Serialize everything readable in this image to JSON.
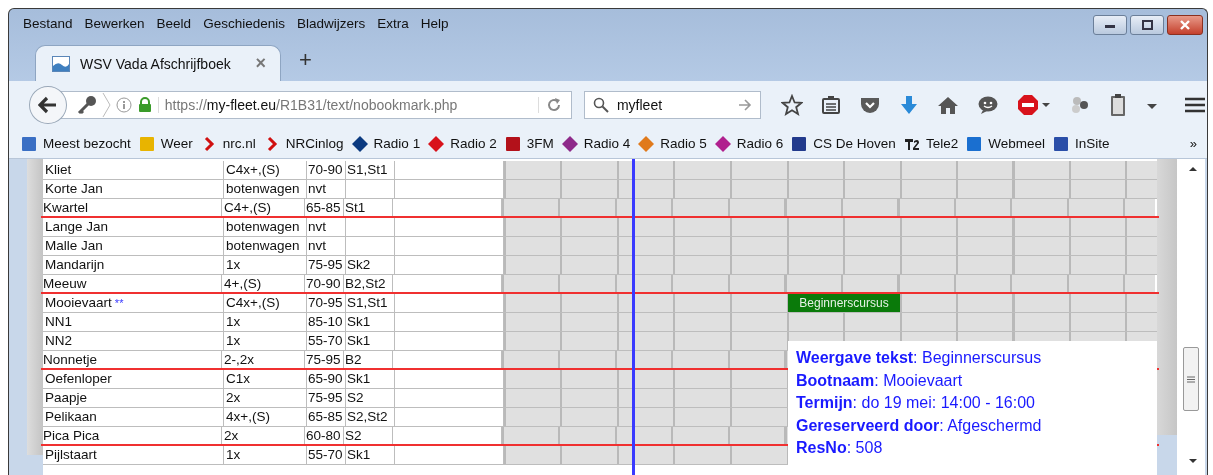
{
  "menu": [
    {
      "label": "Bestand"
    },
    {
      "label": "Bewerken"
    },
    {
      "label": "Beeld"
    },
    {
      "label": "Geschiedenis"
    },
    {
      "label": "Bladwijzers"
    },
    {
      "label": "Extra"
    },
    {
      "label": "Help"
    }
  ],
  "tabs": [
    {
      "title": "WSV Vada Afschrijfboek",
      "selected": true,
      "close": "×"
    }
  ],
  "new_tab": "+",
  "address": {
    "scheme": "https://",
    "host": "my-fleet.eu",
    "path": "/R1B31/text/nobookmark.php"
  },
  "search": {
    "value": "myfleet"
  },
  "bookmarks": [
    {
      "label": "Meest bezocht"
    },
    {
      "label": "Weer"
    },
    {
      "label": "nrc.nl"
    },
    {
      "label": "NRCinlog"
    },
    {
      "label": "Radio 1"
    },
    {
      "label": "Radio 2"
    },
    {
      "label": "3FM"
    },
    {
      "label": "Radio 4"
    },
    {
      "label": "Radio 5"
    },
    {
      "label": "Radio 6"
    },
    {
      "label": "CS De Hoven"
    },
    {
      "label": "Tele2"
    },
    {
      "label": "Webmeel"
    },
    {
      "label": "InSite"
    }
  ],
  "bookmarks_more": "»",
  "rows": [
    {
      "name": "Kliet",
      "type": "C4x+,(S)",
      "weight": "70-90",
      "code": "S1,St1",
      "separator_below": false
    },
    {
      "name": "Korte Jan",
      "type": "botenwagen",
      "weight": "nvt",
      "separator_below": false
    },
    {
      "name": "Kwartel",
      "type": "C4+,(S)",
      "weight": "65-85",
      "code": "St1",
      "separator_below": true
    },
    {
      "name": "Lange Jan",
      "type": "botenwagen",
      "weight": "nvt",
      "separator_below": false
    },
    {
      "name": "Malle Jan",
      "type": "botenwagen",
      "weight": "nvt",
      "separator_below": false
    },
    {
      "name": "Mandarijn",
      "type": "1x",
      "weight": "75-95",
      "code": "Sk2",
      "separator_below": false
    },
    {
      "name": "Meeuw",
      "type": "4+,(S)",
      "weight": "70-90",
      "code": "B2,St2",
      "separator_below": true
    },
    {
      "name": "Mooievaart",
      "flag": "**",
      "type": "C4x+,(S)",
      "weight": "70-95",
      "code": "S1,St1",
      "separator_below": false,
      "booking": {
        "label": "Beginnerscursus",
        "color": "#0a7a0a"
      }
    },
    {
      "name": "NN1",
      "type": "1x",
      "weight": "85-10",
      "code": "Sk1",
      "separator_below": false
    },
    {
      "name": "NN2",
      "type": "1x",
      "weight": "55-70",
      "code": "Sk1",
      "separator_below": false
    },
    {
      "name": "Nonnetje",
      "type": "2-,2x",
      "weight": "75-95",
      "code": "B2",
      "separator_below": true
    },
    {
      "name": "Oefenloper",
      "type": "C1x",
      "weight": "65-90",
      "code": "Sk1",
      "separator_below": false
    },
    {
      "name": "Paapje",
      "type": "2x",
      "weight": "75-95",
      "code": "S2",
      "separator_below": false
    },
    {
      "name": "Pelikaan",
      "type": "4x+,(S)",
      "weight": "65-85",
      "code": "S2,St2",
      "separator_below": false
    },
    {
      "name": "Pica Pica",
      "type": "2x",
      "weight": "60-80",
      "code": "S2",
      "separator_below": true
    },
    {
      "name": "Pijlstaart",
      "type": "1x",
      "weight": "55-70",
      "code": "Sk1",
      "separator_below": false
    }
  ],
  "tooltip": [
    "**Weergave tekst**: Beginnerscursus",
    "**Bootnaam**: Mooievaart",
    "**Termijn**: do 19 mei: 14:00 - 16:00",
    "**Gereserveerd door**: Afgeschermd",
    "**ResNo**: 508"
  ]
}
